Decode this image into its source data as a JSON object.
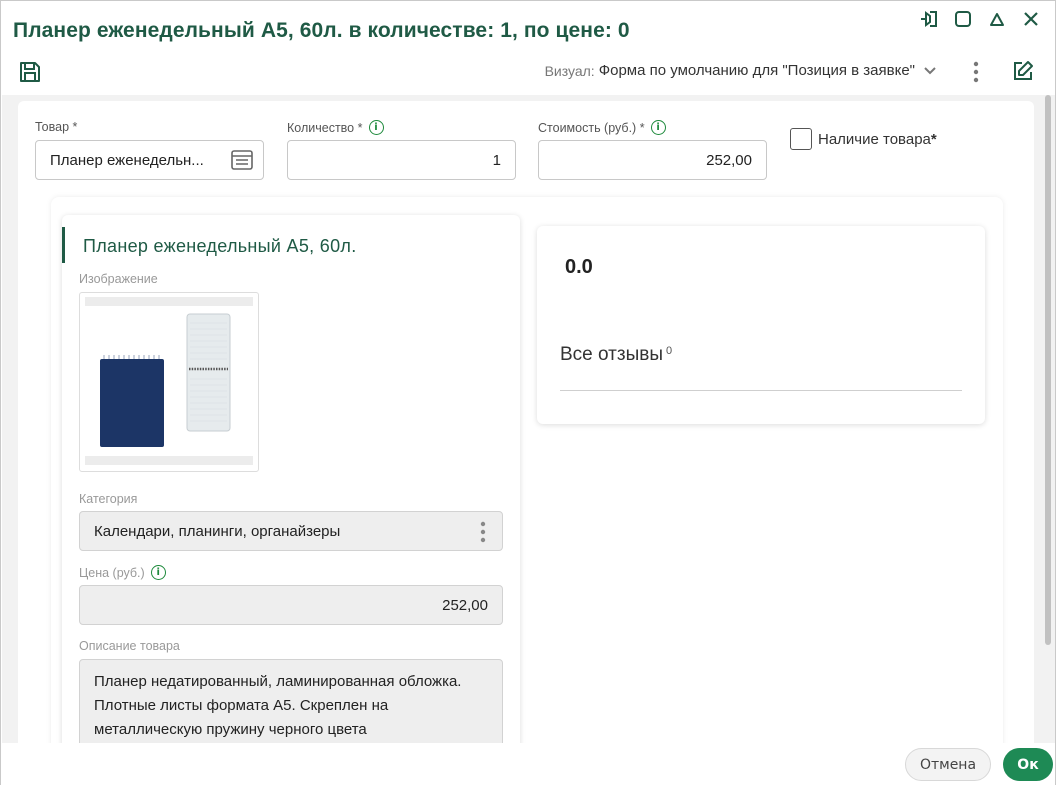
{
  "header": {
    "title": "Планер еженедельный А5, 60л. в количестве: 1, по цене: 0",
    "visual_label": "Визуал:",
    "visual_value": "Форма по умолчанию для \"Позиция в заявке\""
  },
  "form": {
    "product": {
      "label": "Товар",
      "required_mark": "*",
      "value": "Планер еженедельн..."
    },
    "quantity": {
      "label": "Количество",
      "required_mark": "*",
      "value": "1"
    },
    "cost": {
      "label": "Стоимость (руб.)",
      "required_mark": "*",
      "value": "252,00"
    },
    "availability": {
      "label": "Наличие товара",
      "required_mark": "*",
      "checked": false
    }
  },
  "product_card": {
    "title": "Планер еженедельный А5, 60л.",
    "image_label": "Изображение",
    "category_label": "Категория",
    "category_value": "Календари, планинги, органайзеры",
    "price_label": "Цена (руб.)",
    "price_value": "252,00",
    "description_label": "Описание товара",
    "description_value": "Планер недатированный, ламинированная обложка. Плотные листы формата А5. Скреплен на металлическую пружину черного цвета"
  },
  "reviews_card": {
    "rating": "0.0",
    "reviews_label": "Все отзывы",
    "reviews_count": "0"
  },
  "footer": {
    "cancel_label": "Отмена",
    "ok_label": "Ок"
  },
  "colors": {
    "title_green": "#1f5a45",
    "info_green": "#1e8a3c",
    "ok_button": "#1e8a55"
  },
  "icons": [
    "pin-icon",
    "maximize-icon",
    "collapse-icon",
    "close-icon",
    "save-icon",
    "chevron-down-icon",
    "more-vertical-icon",
    "edit-icon",
    "info-icon",
    "lookup-list-icon"
  ]
}
